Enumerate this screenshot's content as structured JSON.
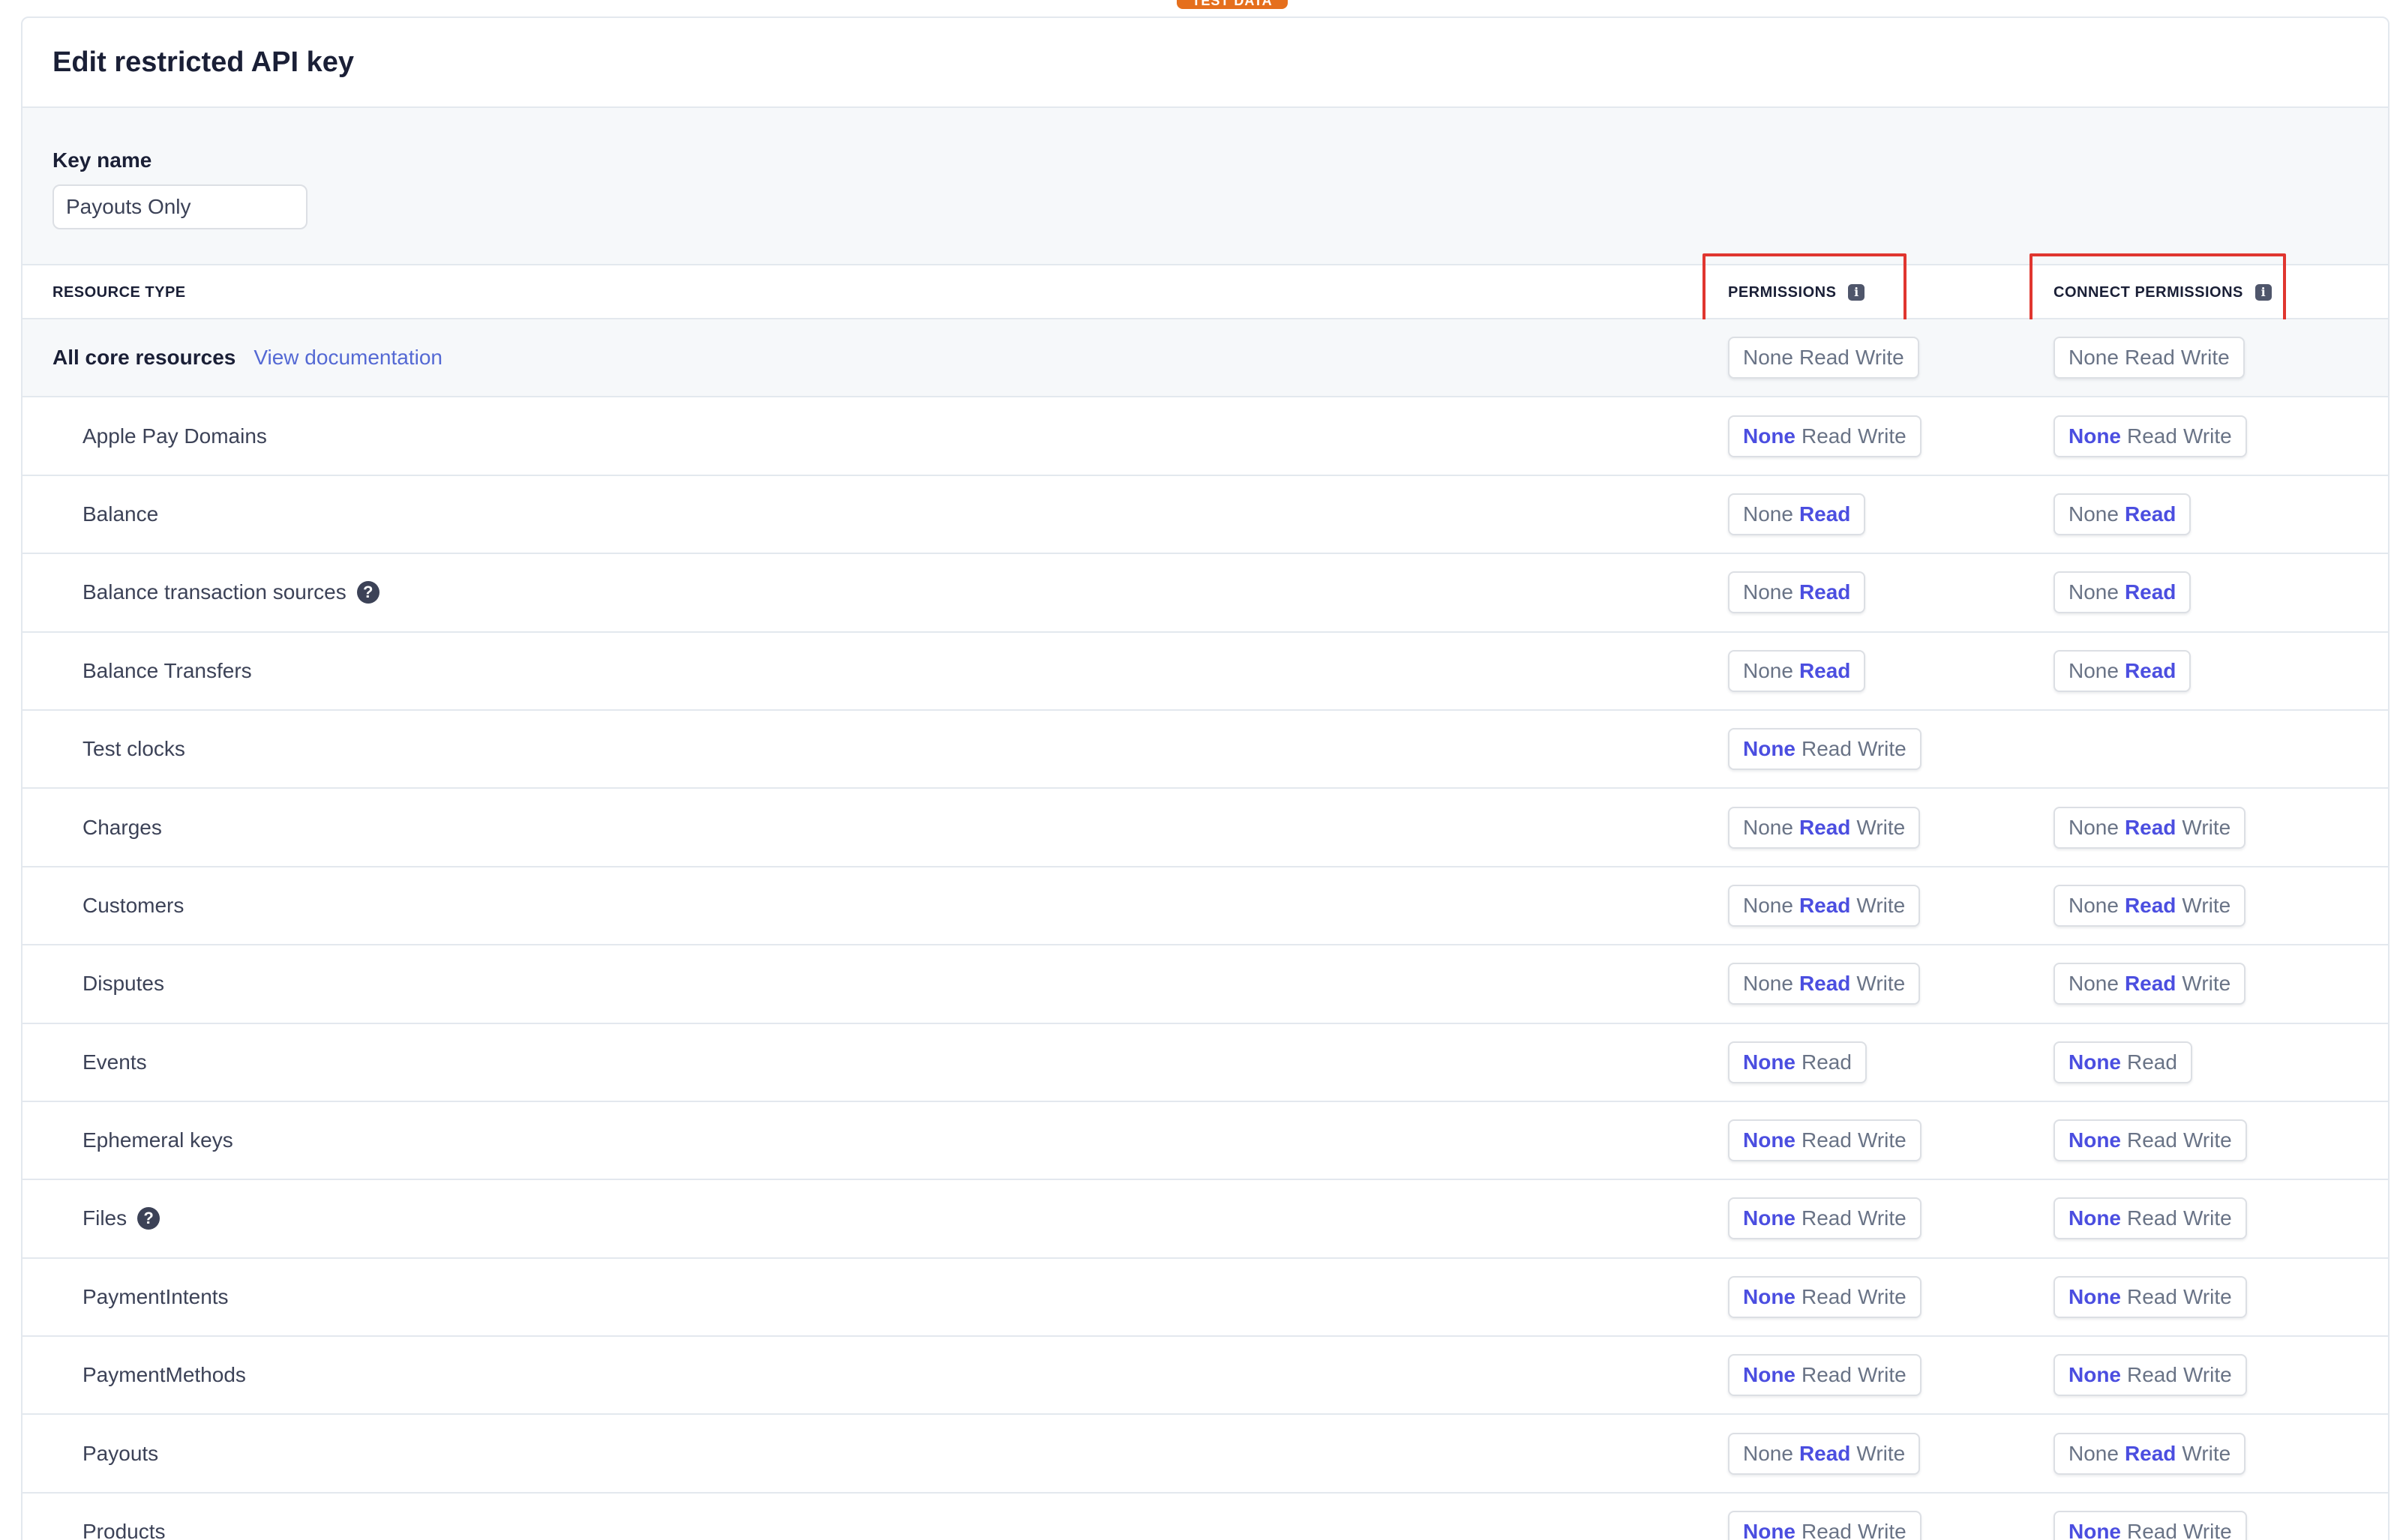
{
  "badge": "TEST DATA",
  "title": "Edit restricted API key",
  "key_name": {
    "label": "Key name",
    "value": "Payouts Only"
  },
  "headers": {
    "resource_type": "RESOURCE TYPE",
    "permissions": "PERMISSIONS",
    "connect_permissions": "CONNECT PERMISSIONS"
  },
  "core": {
    "label": "All core resources",
    "link": "View documentation",
    "perm": {
      "options": [
        "None",
        "Read",
        "Write"
      ],
      "selected": null
    },
    "connect": {
      "options": [
        "None",
        "Read",
        "Write"
      ],
      "selected": null
    }
  },
  "rows": [
    {
      "label": "Apple Pay Domains",
      "help": false,
      "perm": {
        "options": [
          "None",
          "Read",
          "Write"
        ],
        "selected": "None"
      },
      "connect": {
        "options": [
          "None",
          "Read",
          "Write"
        ],
        "selected": "None"
      }
    },
    {
      "label": "Balance",
      "help": false,
      "perm": {
        "options": [
          "None",
          "Read"
        ],
        "selected": "Read"
      },
      "connect": {
        "options": [
          "None",
          "Read"
        ],
        "selected": "Read"
      }
    },
    {
      "label": "Balance transaction sources",
      "help": true,
      "perm": {
        "options": [
          "None",
          "Read"
        ],
        "selected": "Read"
      },
      "connect": {
        "options": [
          "None",
          "Read"
        ],
        "selected": "Read"
      }
    },
    {
      "label": "Balance Transfers",
      "help": false,
      "perm": {
        "options": [
          "None",
          "Read"
        ],
        "selected": "Read"
      },
      "connect": {
        "options": [
          "None",
          "Read"
        ],
        "selected": "Read"
      }
    },
    {
      "label": "Test clocks",
      "help": false,
      "perm": {
        "options": [
          "None",
          "Read",
          "Write"
        ],
        "selected": "None"
      },
      "connect": null
    },
    {
      "label": "Charges",
      "help": false,
      "perm": {
        "options": [
          "None",
          "Read",
          "Write"
        ],
        "selected": "Read"
      },
      "connect": {
        "options": [
          "None",
          "Read",
          "Write"
        ],
        "selected": "Read"
      }
    },
    {
      "label": "Customers",
      "help": false,
      "perm": {
        "options": [
          "None",
          "Read",
          "Write"
        ],
        "selected": "Read"
      },
      "connect": {
        "options": [
          "None",
          "Read",
          "Write"
        ],
        "selected": "Read"
      }
    },
    {
      "label": "Disputes",
      "help": false,
      "perm": {
        "options": [
          "None",
          "Read",
          "Write"
        ],
        "selected": "Read"
      },
      "connect": {
        "options": [
          "None",
          "Read",
          "Write"
        ],
        "selected": "Read"
      }
    },
    {
      "label": "Events",
      "help": false,
      "perm": {
        "options": [
          "None",
          "Read"
        ],
        "selected": "None"
      },
      "connect": {
        "options": [
          "None",
          "Read"
        ],
        "selected": "None"
      }
    },
    {
      "label": "Ephemeral keys",
      "help": false,
      "perm": {
        "options": [
          "None",
          "Read",
          "Write"
        ],
        "selected": "None"
      },
      "connect": {
        "options": [
          "None",
          "Read",
          "Write"
        ],
        "selected": "None"
      }
    },
    {
      "label": "Files",
      "help": true,
      "perm": {
        "options": [
          "None",
          "Read",
          "Write"
        ],
        "selected": "None"
      },
      "connect": {
        "options": [
          "None",
          "Read",
          "Write"
        ],
        "selected": "None"
      }
    },
    {
      "label": "PaymentIntents",
      "help": false,
      "perm": {
        "options": [
          "None",
          "Read",
          "Write"
        ],
        "selected": "None"
      },
      "connect": {
        "options": [
          "None",
          "Read",
          "Write"
        ],
        "selected": "None"
      }
    },
    {
      "label": "PaymentMethods",
      "help": false,
      "perm": {
        "options": [
          "None",
          "Read",
          "Write"
        ],
        "selected": "None"
      },
      "connect": {
        "options": [
          "None",
          "Read",
          "Write"
        ],
        "selected": "None"
      }
    },
    {
      "label": "Payouts",
      "help": false,
      "perm": {
        "options": [
          "None",
          "Read",
          "Write"
        ],
        "selected": "Read"
      },
      "connect": {
        "options": [
          "None",
          "Read",
          "Write"
        ],
        "selected": "Read"
      }
    },
    {
      "label": "Products",
      "help": false,
      "perm": {
        "options": [
          "None",
          "Read",
          "Write"
        ],
        "selected": "None"
      },
      "connect": {
        "options": [
          "None",
          "Read",
          "Write"
        ],
        "selected": "None"
      }
    }
  ],
  "colors": {
    "accent": "#4b4ee0",
    "highlight": "#e0362f",
    "badge": "#e56f1d"
  }
}
